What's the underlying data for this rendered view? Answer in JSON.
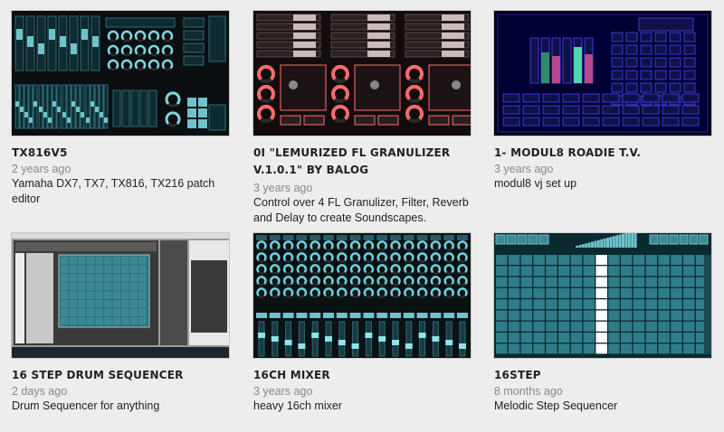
{
  "cards": [
    {
      "title": "TX816V5",
      "age": "2 years ago",
      "desc": "Yamaha DX7, TX7, TX816, TX216 patch editor"
    },
    {
      "title": "0I \"LEMURIZED FL GRANULIZER V.1.0.1\" BY BALOG",
      "age": "3 years ago",
      "desc": "Control over 4 FL Granulizer, Filter, Reverb and Delay to create Soundscapes."
    },
    {
      "title": "1- MODUL8 ROADIE T.V.",
      "age": "3 years ago",
      "desc": "modul8 vj set up"
    },
    {
      "title": "16 STEP DRUM SEQUENCER",
      "age": "2 days ago",
      "desc": "Drum Sequencer for anything"
    },
    {
      "title": "16CH MIXER",
      "age": "3 years ago",
      "desc": "heavy 16ch mixer"
    },
    {
      "title": "16STEP",
      "age": "8 months ago",
      "desc": "Melodic Step Sequencer"
    }
  ]
}
